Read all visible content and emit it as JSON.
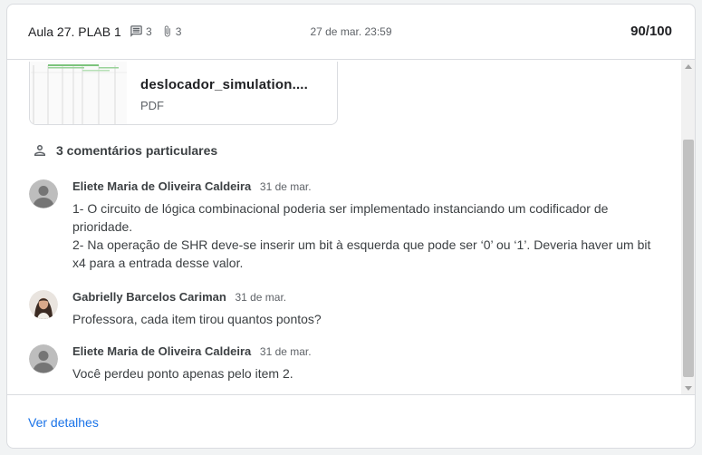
{
  "header": {
    "title": "Aula 27. PLAB 1",
    "comments_count": "3",
    "attachments_count": "3",
    "date": "27 de mar. 23:59",
    "grade": "90/100"
  },
  "attachment": {
    "name": "deslocador_simulation....",
    "type": "PDF"
  },
  "comments_section": {
    "label": "3 comentários particulares"
  },
  "comments": [
    {
      "author": "Eliete Maria de Oliveira Caldeira",
      "date": "31 de mar.",
      "text_line1": "1- O circuito de lógica combinacional poderia ser implementado instanciando um codificador de prioridade.",
      "text_line2": "2- Na operação de SHR deve-se inserir um bit à esquerda que pode ser ‘0’ ou ‘1’. Deveria haver um bit x4 para a entrada desse valor."
    },
    {
      "author": "Gabrielly Barcelos Cariman",
      "date": "31 de mar.",
      "text_line1": "Professora, cada item tirou quantos pontos?"
    },
    {
      "author": "Eliete Maria de Oliveira Caldeira",
      "date": "31 de mar.",
      "text_line1": "Você perdeu ponto apenas pelo item 2."
    }
  ],
  "footer": {
    "link": "Ver detalhes"
  },
  "colors": {
    "link": "#1a73e8",
    "border": "#dadce0",
    "text": "#3c4043"
  }
}
